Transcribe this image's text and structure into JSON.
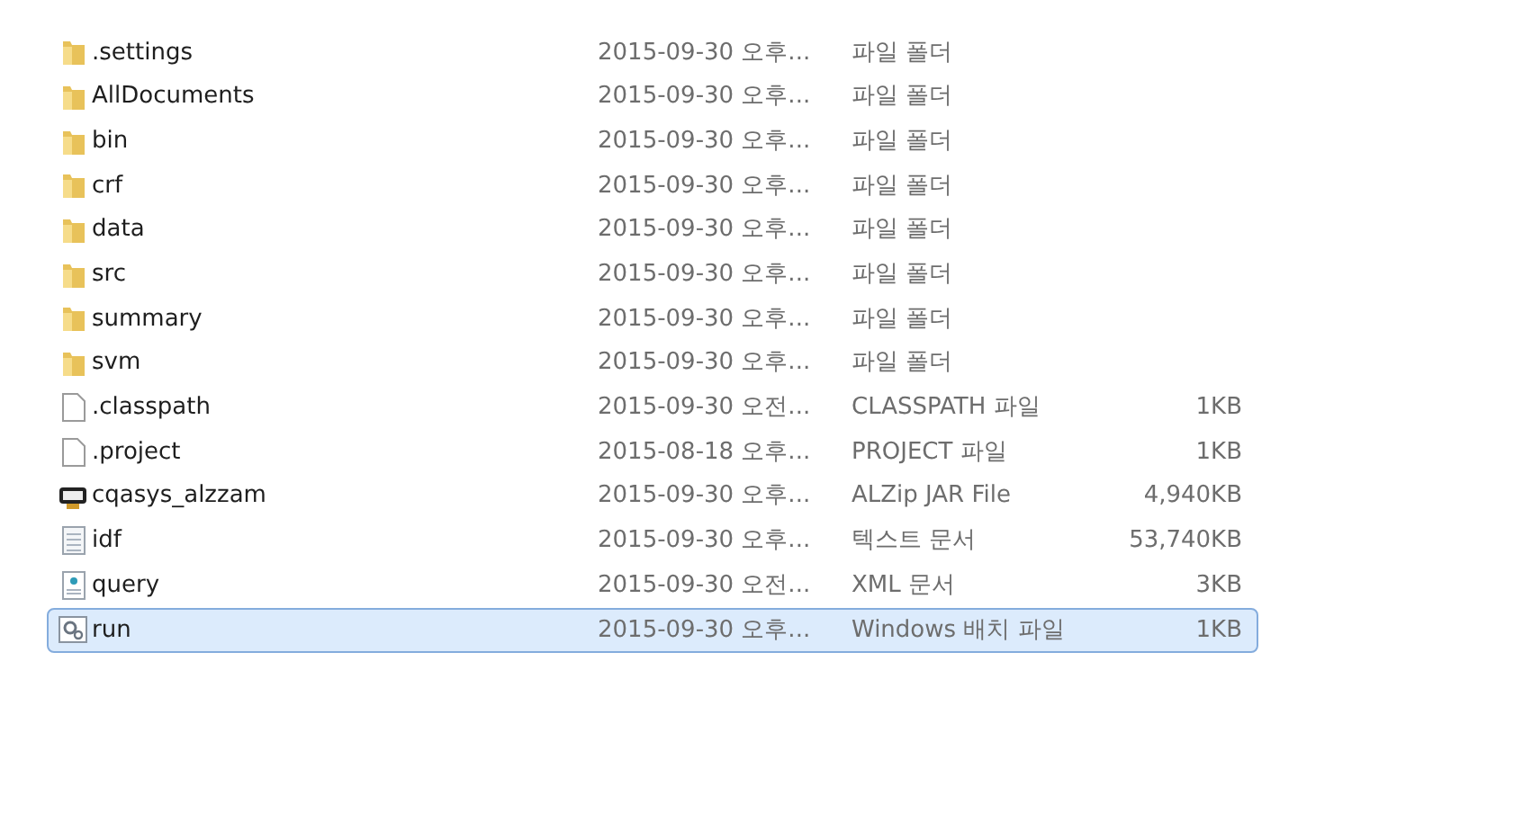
{
  "files": [
    {
      "name": ".settings",
      "kind": "folder",
      "date": "2015-09-30 오후...",
      "type": "파일 폴더",
      "selected": false
    },
    {
      "name": "AllDocuments",
      "kind": "folder",
      "date": "2015-09-30 오후...",
      "type": "파일 폴더",
      "selected": false
    },
    {
      "name": "bin",
      "kind": "folder",
      "date": "2015-09-30 오후...",
      "type": "파일 폴더",
      "selected": false
    },
    {
      "name": "crf",
      "kind": "folder",
      "date": "2015-09-30 오후...",
      "type": "파일 폴더",
      "selected": false
    },
    {
      "name": "data",
      "kind": "folder",
      "date": "2015-09-30 오후...",
      "type": "파일 폴더",
      "selected": false
    },
    {
      "name": "src",
      "kind": "folder",
      "date": "2015-09-30 오후...",
      "type": "파일 폴더",
      "selected": false
    },
    {
      "name": "summary",
      "kind": "folder",
      "date": "2015-09-30 오후...",
      "type": "파일 폴더",
      "selected": false
    },
    {
      "name": "svm",
      "kind": "folder",
      "date": "2015-09-30 오후...",
      "type": "파일 폴더",
      "selected": false
    },
    {
      "name": ".classpath",
      "kind": "blank",
      "date": "2015-09-30 오전...",
      "type": "CLASSPATH 파일",
      "size": "1KB",
      "selected": false
    },
    {
      "name": ".project",
      "kind": "blank",
      "date": "2015-08-18 오후...",
      "type": "PROJECT 파일",
      "size": "1KB",
      "selected": false
    },
    {
      "name": "cqasys_alzzam",
      "kind": "jar",
      "date": "2015-09-30 오후...",
      "type": "ALZip JAR File",
      "size": "4,940KB",
      "selected": false
    },
    {
      "name": "idf",
      "kind": "text",
      "date": "2015-09-30 오후...",
      "type": "텍스트 문서",
      "size": "53,740KB",
      "selected": false
    },
    {
      "name": "query",
      "kind": "xml",
      "date": "2015-09-30 오전...",
      "type": "XML 문서",
      "size": "3KB",
      "selected": false
    },
    {
      "name": "run",
      "kind": "batch",
      "date": "2015-09-30 오후...",
      "type": "Windows 배치 파일",
      "size": "1KB",
      "selected": true
    }
  ]
}
